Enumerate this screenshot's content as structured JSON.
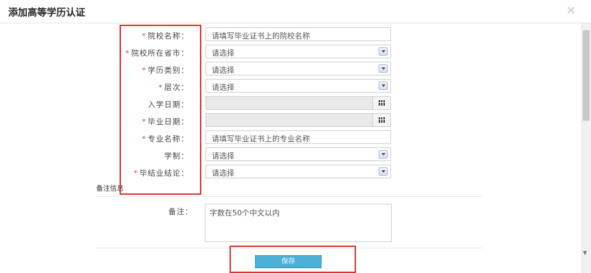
{
  "dialog": {
    "title": "添加高等学历认证",
    "close_glyph": "✕"
  },
  "form": {
    "rows": [
      {
        "required": true,
        "label": "院校名称：",
        "type": "text",
        "value": "请填写毕业证书上的院校名称"
      },
      {
        "required": true,
        "label": "院校所在省市：",
        "type": "select",
        "value": "请选择"
      },
      {
        "required": true,
        "label": "学历类别：",
        "type": "select",
        "value": "请选择"
      },
      {
        "required": true,
        "label": "层次：",
        "type": "select",
        "value": "请选择"
      },
      {
        "required": false,
        "label": "入学日期：",
        "type": "date",
        "value": ""
      },
      {
        "required": true,
        "label": "毕业日期：",
        "type": "date",
        "value": ""
      },
      {
        "required": true,
        "label": "专业名称：",
        "type": "text",
        "value": "请填写毕业证书上的专业名称"
      },
      {
        "required": false,
        "label": "学制：",
        "type": "select",
        "value": "请选择"
      },
      {
        "required": true,
        "label": "毕结业结论：",
        "type": "select",
        "value": "请选择"
      }
    ],
    "required_mark": "*"
  },
  "notes": {
    "section_title": "备注信息",
    "label": "备注：",
    "placeholder": "字数在50个中文以内"
  },
  "actions": {
    "save_label": "保存"
  },
  "colors": {
    "accent": "#4bafd6",
    "required": "#e03e3e",
    "highlight": "#d9302c"
  }
}
